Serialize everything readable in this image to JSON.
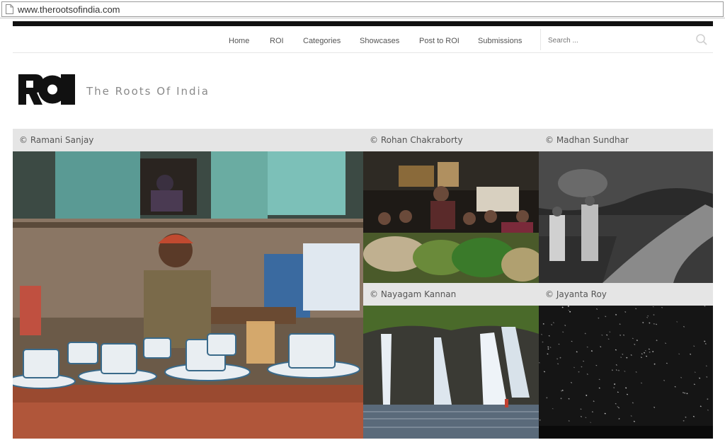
{
  "browser": {
    "url": "www.therootsofindia.com"
  },
  "nav": {
    "items": [
      "Home",
      "ROI",
      "Categories",
      "Showcases",
      "Post to ROI",
      "Submissions"
    ],
    "search_placeholder": "Search ..."
  },
  "site": {
    "logo_text": "ROI",
    "title": "The Roots Of India"
  },
  "gallery": {
    "tiles": [
      {
        "credit": "© Ramani Sanjay"
      },
      {
        "credit": "© Rohan Chakraborty"
      },
      {
        "credit": "© Madhan Sundhar"
      },
      {
        "credit": "© Nayagam Kannan"
      },
      {
        "credit": "© Jayanta Roy"
      }
    ]
  },
  "colors": {
    "topbar": "#111111",
    "caption_bg": "#e5e5e5",
    "title_gray": "#8a8a8a"
  }
}
